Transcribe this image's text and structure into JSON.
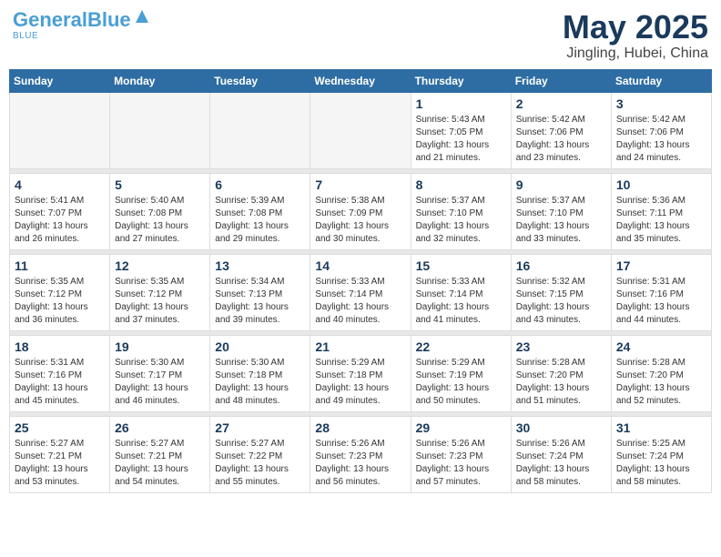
{
  "header": {
    "logo_line1": "General",
    "logo_line2": "Blue",
    "month_title": "May 2025",
    "location": "Jingling, Hubei, China"
  },
  "weekdays": [
    "Sunday",
    "Monday",
    "Tuesday",
    "Wednesday",
    "Thursday",
    "Friday",
    "Saturday"
  ],
  "weeks": [
    [
      {
        "day": "",
        "info": ""
      },
      {
        "day": "",
        "info": ""
      },
      {
        "day": "",
        "info": ""
      },
      {
        "day": "",
        "info": ""
      },
      {
        "day": "1",
        "info": "Sunrise: 5:43 AM\nSunset: 7:05 PM\nDaylight: 13 hours\nand 21 minutes."
      },
      {
        "day": "2",
        "info": "Sunrise: 5:42 AM\nSunset: 7:06 PM\nDaylight: 13 hours\nand 23 minutes."
      },
      {
        "day": "3",
        "info": "Sunrise: 5:42 AM\nSunset: 7:06 PM\nDaylight: 13 hours\nand 24 minutes."
      }
    ],
    [
      {
        "day": "4",
        "info": "Sunrise: 5:41 AM\nSunset: 7:07 PM\nDaylight: 13 hours\nand 26 minutes."
      },
      {
        "day": "5",
        "info": "Sunrise: 5:40 AM\nSunset: 7:08 PM\nDaylight: 13 hours\nand 27 minutes."
      },
      {
        "day": "6",
        "info": "Sunrise: 5:39 AM\nSunset: 7:08 PM\nDaylight: 13 hours\nand 29 minutes."
      },
      {
        "day": "7",
        "info": "Sunrise: 5:38 AM\nSunset: 7:09 PM\nDaylight: 13 hours\nand 30 minutes."
      },
      {
        "day": "8",
        "info": "Sunrise: 5:37 AM\nSunset: 7:10 PM\nDaylight: 13 hours\nand 32 minutes."
      },
      {
        "day": "9",
        "info": "Sunrise: 5:37 AM\nSunset: 7:10 PM\nDaylight: 13 hours\nand 33 minutes."
      },
      {
        "day": "10",
        "info": "Sunrise: 5:36 AM\nSunset: 7:11 PM\nDaylight: 13 hours\nand 35 minutes."
      }
    ],
    [
      {
        "day": "11",
        "info": "Sunrise: 5:35 AM\nSunset: 7:12 PM\nDaylight: 13 hours\nand 36 minutes."
      },
      {
        "day": "12",
        "info": "Sunrise: 5:35 AM\nSunset: 7:12 PM\nDaylight: 13 hours\nand 37 minutes."
      },
      {
        "day": "13",
        "info": "Sunrise: 5:34 AM\nSunset: 7:13 PM\nDaylight: 13 hours\nand 39 minutes."
      },
      {
        "day": "14",
        "info": "Sunrise: 5:33 AM\nSunset: 7:14 PM\nDaylight: 13 hours\nand 40 minutes."
      },
      {
        "day": "15",
        "info": "Sunrise: 5:33 AM\nSunset: 7:14 PM\nDaylight: 13 hours\nand 41 minutes."
      },
      {
        "day": "16",
        "info": "Sunrise: 5:32 AM\nSunset: 7:15 PM\nDaylight: 13 hours\nand 43 minutes."
      },
      {
        "day": "17",
        "info": "Sunrise: 5:31 AM\nSunset: 7:16 PM\nDaylight: 13 hours\nand 44 minutes."
      }
    ],
    [
      {
        "day": "18",
        "info": "Sunrise: 5:31 AM\nSunset: 7:16 PM\nDaylight: 13 hours\nand 45 minutes."
      },
      {
        "day": "19",
        "info": "Sunrise: 5:30 AM\nSunset: 7:17 PM\nDaylight: 13 hours\nand 46 minutes."
      },
      {
        "day": "20",
        "info": "Sunrise: 5:30 AM\nSunset: 7:18 PM\nDaylight: 13 hours\nand 48 minutes."
      },
      {
        "day": "21",
        "info": "Sunrise: 5:29 AM\nSunset: 7:18 PM\nDaylight: 13 hours\nand 49 minutes."
      },
      {
        "day": "22",
        "info": "Sunrise: 5:29 AM\nSunset: 7:19 PM\nDaylight: 13 hours\nand 50 minutes."
      },
      {
        "day": "23",
        "info": "Sunrise: 5:28 AM\nSunset: 7:20 PM\nDaylight: 13 hours\nand 51 minutes."
      },
      {
        "day": "24",
        "info": "Sunrise: 5:28 AM\nSunset: 7:20 PM\nDaylight: 13 hours\nand 52 minutes."
      }
    ],
    [
      {
        "day": "25",
        "info": "Sunrise: 5:27 AM\nSunset: 7:21 PM\nDaylight: 13 hours\nand 53 minutes."
      },
      {
        "day": "26",
        "info": "Sunrise: 5:27 AM\nSunset: 7:21 PM\nDaylight: 13 hours\nand 54 minutes."
      },
      {
        "day": "27",
        "info": "Sunrise: 5:27 AM\nSunset: 7:22 PM\nDaylight: 13 hours\nand 55 minutes."
      },
      {
        "day": "28",
        "info": "Sunrise: 5:26 AM\nSunset: 7:23 PM\nDaylight: 13 hours\nand 56 minutes."
      },
      {
        "day": "29",
        "info": "Sunrise: 5:26 AM\nSunset: 7:23 PM\nDaylight: 13 hours\nand 57 minutes."
      },
      {
        "day": "30",
        "info": "Sunrise: 5:26 AM\nSunset: 7:24 PM\nDaylight: 13 hours\nand 58 minutes."
      },
      {
        "day": "31",
        "info": "Sunrise: 5:25 AM\nSunset: 7:24 PM\nDaylight: 13 hours\nand 58 minutes."
      }
    ]
  ]
}
